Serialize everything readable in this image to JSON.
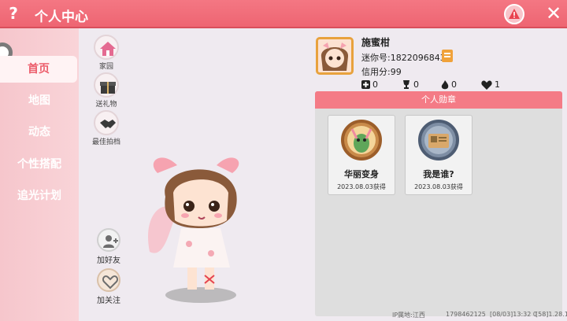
{
  "title": "个人中心",
  "help_icon": "question-mark-icon",
  "sidebar": {
    "items": [
      {
        "label": "首页",
        "active": true
      },
      {
        "label": "地图",
        "active": false
      },
      {
        "label": "动态",
        "active": false
      },
      {
        "label": "个性搭配",
        "active": false
      },
      {
        "label": "追光计划",
        "active": false
      }
    ]
  },
  "tools": [
    {
      "label": "家园",
      "icon": "house-icon"
    },
    {
      "label": "送礼物",
      "icon": "gift-icon"
    },
    {
      "label": "最佳拍档",
      "icon": "handshake-icon"
    }
  ],
  "social": {
    "add_friend": "加好友",
    "follow": "加关注"
  },
  "profile": {
    "name": "施蜜柑",
    "uid": "迷你号:1822096843",
    "credit": "信用分:99"
  },
  "stats": [
    {
      "icon": "plus-icon",
      "value": "0"
    },
    {
      "icon": "trophy-icon",
      "value": "0"
    },
    {
      "icon": "flame-icon",
      "value": "0"
    },
    {
      "icon": "heart-icon",
      "value": "1"
    }
  ],
  "medals": {
    "header": "个人勋章",
    "items": [
      {
        "name": "华丽变身",
        "date": "2023.08.03获得"
      },
      {
        "name": "我是谁?",
        "date": "2023.08.03获得"
      }
    ]
  },
  "footer": {
    "region": "IP属地:江西",
    "id": "1798462125",
    "time": "[08/03]13:32 0",
    "version": "[58]1.28.1"
  },
  "colors": {
    "titlebar": "#ee6572",
    "accent": "#f47b86",
    "sidebar": "#f7c9ce"
  }
}
